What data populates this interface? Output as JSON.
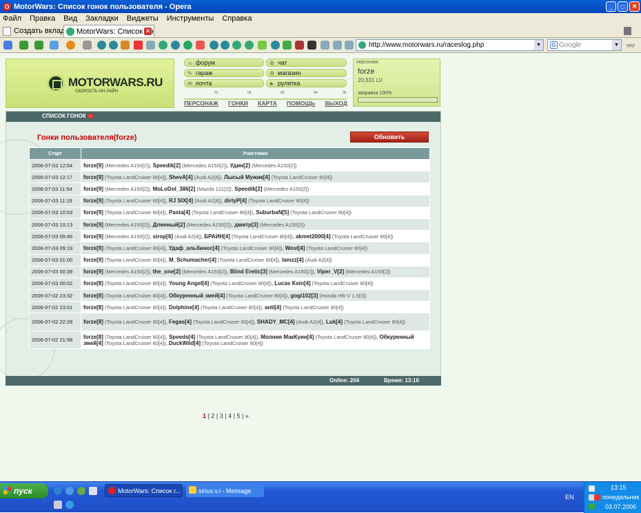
{
  "window": {
    "title": "MotorWars: Список гонок пользователя - Opera"
  },
  "menu": [
    "Файл",
    "Правка",
    "Вид",
    "Закладки",
    "Виджеты",
    "Инструменты",
    "Справка"
  ],
  "tabs": {
    "new_tab": "Создать вкладку",
    "active_tab": "MotorWars: Список гон..."
  },
  "address": {
    "url": "http://www.motorwars.ru/raceslog.php",
    "search_placeholder": "Google"
  },
  "site": {
    "brand": "MOTORWARS.RU",
    "slogan": "СКОРОСТЬ ОН-ЛАЙН",
    "nav_buttons": [
      "форум",
      "чат",
      "гараж",
      "магазин",
      "почта",
      "рулетка"
    ],
    "gauge_marks": [
      "01",
      "02",
      "03",
      "04",
      "05"
    ],
    "nav_links": [
      "ПЕРСОНАЖ",
      "ГОНКИ",
      "КАРТА",
      "ПОМОЩЬ",
      "ВЫХОД"
    ],
    "persona": {
      "label": "персонаж:",
      "name": "forze",
      "lv": "20,631 LV",
      "fuel_label": "заправка 100%",
      "fuel_level": 1.0
    }
  },
  "races": {
    "header": "СПИСОК ГОНОК",
    "title": "Гонки пользователя(forze)",
    "refresh": "Обновить",
    "columns": [
      "Старт",
      "Участники"
    ],
    "rows": [
      {
        "date": "2006-07-03 12:54",
        "participants": [
          {
            "n": "forze[9]",
            "c": "(Mercedes A150[2])"
          },
          {
            "n": "Speedik[2]",
            "c": "(Mercedes A150[2])"
          },
          {
            "n": "Удин[2]",
            "c": "(Mercedes A150[2])"
          }
        ]
      },
      {
        "date": "2006-07-03 12:17",
        "participants": [
          {
            "n": "forze[9]",
            "c": "(Toyota LandCruiser 80[4])"
          },
          {
            "n": "ShevA[4]",
            "c": "(Audi A2[4])"
          },
          {
            "n": "Лысый Мужик[4]",
            "c": "(Toyota LandCruiser 80[4])"
          }
        ]
      },
      {
        "date": "2006-07-03 11:54",
        "participants": [
          {
            "n": "forze[9]",
            "c": "(Mercedes A150[2])"
          },
          {
            "n": "MoLoDoI_386[2]",
            "c": "(Mazda 121[2])"
          },
          {
            "n": "Speedik[2]",
            "c": "(Mercedes A150[2])"
          }
        ]
      },
      {
        "date": "2006-07-03 11:19",
        "participants": [
          {
            "n": "forze[9]",
            "c": "(Toyota LandCruiser 80[4])"
          },
          {
            "n": "RJ SIX[4]",
            "c": "(Audi A2[4])"
          },
          {
            "n": "dirtyP[4]",
            "c": "(Toyota LandCruiser 80[4])"
          }
        ]
      },
      {
        "date": "2006-07-03 10:53",
        "participants": [
          {
            "n": "forze[9]",
            "c": "(Toyota LandCruiser 80[4])"
          },
          {
            "n": "Pasta[4]",
            "c": "(Toyota LandCruiser 80[4])"
          },
          {
            "n": "SuburbaN[5]",
            "c": "(Toyota LandCruiser 80[4])"
          }
        ]
      },
      {
        "date": "2006-07-03 10:13",
        "participants": [
          {
            "n": "forze[9]",
            "c": "(Mercedes A150[2])"
          },
          {
            "n": "Длинный[2]",
            "c": "(Mercedes A150[2])"
          },
          {
            "n": "дмитр[3]",
            "c": "(Mercedes A150[2])"
          }
        ]
      },
      {
        "date": "2006-07-03 09:46",
        "participants": [
          {
            "n": "forze[9]",
            "c": "(Mercedes A150[2])"
          },
          {
            "n": "sirop[6]",
            "c": "(Audi A2[4])"
          },
          {
            "n": "БРАИН[4]",
            "c": "(Toyota LandCruiser 80[4])"
          },
          {
            "n": "akmet2000[4]",
            "c": "(Toyota LandCruiser 80[4])"
          }
        ]
      },
      {
        "date": "2006-07-03 09:19",
        "participants": [
          {
            "n": "forze[9]",
            "c": "(Toyota LandCruiser 80[4])"
          },
          {
            "n": "Удаф_альбинос[4]",
            "c": "(Toyota LandCruiser 80[4])"
          },
          {
            "n": "West[4]",
            "c": "(Toyota LandCruiser 80[4])"
          }
        ]
      },
      {
        "date": "2006-07-03 01:00",
        "participants": [
          {
            "n": "forze[9]",
            "c": "(Toyota LandCruiser 80[4])"
          },
          {
            "n": "M_Schumacher[4]",
            "c": "(Toyota LandCruiser 80[4])"
          },
          {
            "n": "lamzz[4]",
            "c": "(Audi A2[4])"
          }
        ]
      },
      {
        "date": "2006-07-03 00:39",
        "participants": [
          {
            "n": "forze[9]",
            "c": "(Mercedes A150[2])"
          },
          {
            "n": "the_one[2]",
            "c": "(Mercedes A150[2])"
          },
          {
            "n": "Blind Eretic[3]",
            "c": "(Mercedes A150[2])"
          },
          {
            "n": "Viper_V[2]",
            "c": "(Mercedes A150[2])"
          }
        ]
      },
      {
        "date": "2006-07-03 00:02",
        "participants": [
          {
            "n": "forze[8]",
            "c": "(Toyota LandCruiser 80[4])"
          },
          {
            "n": "Young Angel[4]",
            "c": "(Toyota LandCruiser 80[4])"
          },
          {
            "n": "Lucas Kein[4]",
            "c": "(Toyota LandCruiser 80[4])"
          }
        ]
      },
      {
        "date": "2006-07-02 23:32",
        "participants": [
          {
            "n": "forze[8]",
            "c": "(Toyota LandCruiser 80[4])"
          },
          {
            "n": "Обкуренный змей[4]",
            "c": "(Toyota LandCruiser 80[4])"
          },
          {
            "n": "gogi102[3]",
            "c": "(Honda HR-V 1.6[3])"
          }
        ]
      },
      {
        "date": "2006-07-02 23:01",
        "participants": [
          {
            "n": "forze[8]",
            "c": "(Toyota LandCruiser 80[4])"
          },
          {
            "n": "Dolphine[4]",
            "c": "(Toyota LandCruiser 80[4])"
          },
          {
            "n": "anti[4]",
            "c": "(Toyota LandCruiser 80[4])"
          }
        ]
      },
      {
        "date": "2006-07-02 22:28",
        "participants": [
          {
            "n": "forze[8]",
            "c": "(Toyota LandCruiser 80[4])"
          },
          {
            "n": "Fegas[4]",
            "c": "(Toyota LandCruiser 80[4])"
          },
          {
            "n": "SHADY_MC[4]",
            "c": "(Audi A2[4])"
          },
          {
            "n": "Luk[4]",
            "c": "(Toyota LandCruiser 80[4])"
          }
        ]
      },
      {
        "date": "2006-07-02 21:58",
        "participants": [
          {
            "n": "forze[8]",
            "c": "(Toyota LandCruiser 80[4])"
          },
          {
            "n": "Speeds[4]",
            "c": "(Toyota LandCruiser 80[4])"
          },
          {
            "n": "Молния МакКуин[4]",
            "c": "(Toyota LandCruiser 80[4])"
          },
          {
            "n": "Обкуренный змей[4]",
            "c": "(Toyota LandCruiser 80[4])"
          },
          {
            "n": "DuckWild[4]",
            "c": "(Toyota LandCruiser 80[4])"
          }
        ]
      }
    ],
    "pages": [
      "1",
      "2",
      "3",
      "4",
      "5",
      "»"
    ],
    "current_page": "1",
    "online": "Online: 204",
    "time": "Время: 13:16"
  },
  "taskbar": {
    "start": "пуск",
    "tasks": [
      "MotorWars: Список г...",
      "sirius.v.i - Message"
    ],
    "lang": "EN",
    "clock": "13:15",
    "weekday": "понедельник",
    "date": "03.07.2006"
  },
  "colors": {
    "accent_red": "#c00000",
    "header_teal": "#4d6868",
    "lime": "#d6eb8c",
    "xp_blue": "#2358d4"
  }
}
